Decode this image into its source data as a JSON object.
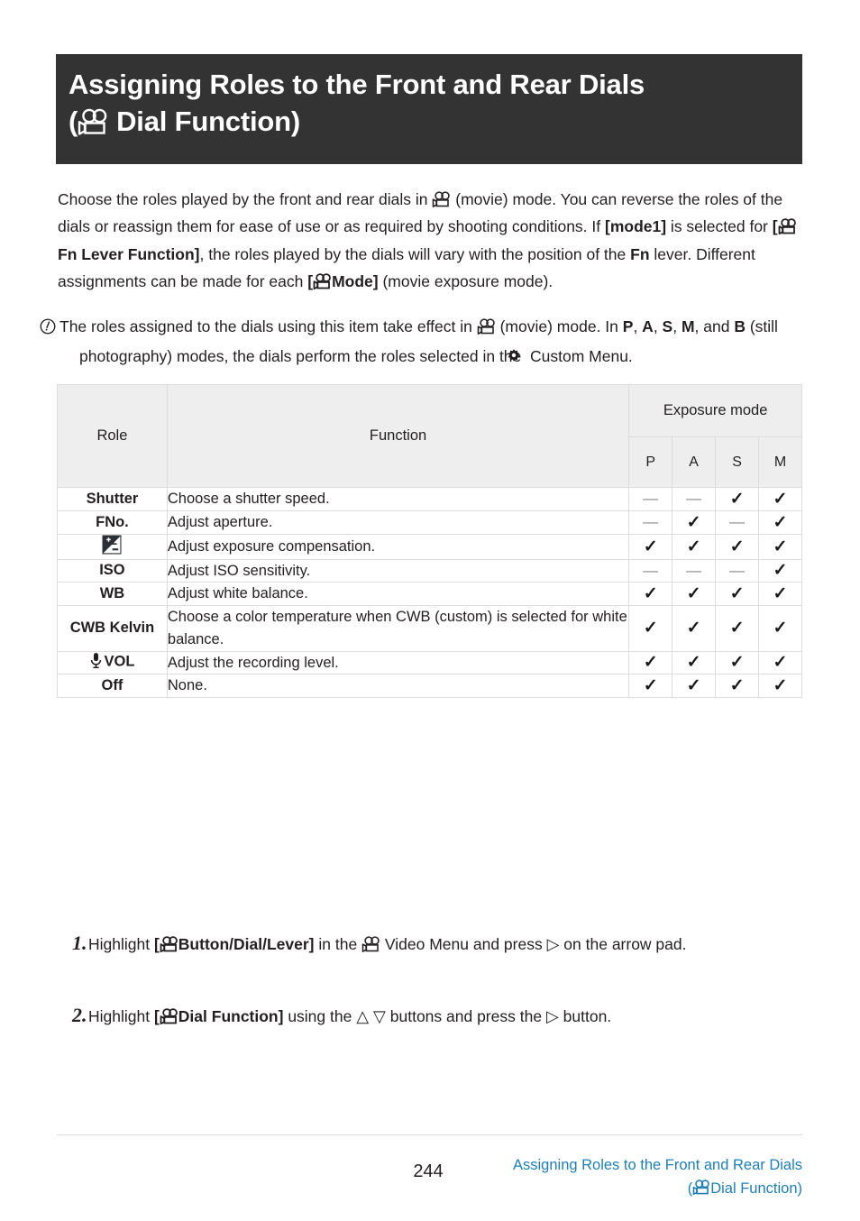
{
  "title": {
    "line1": "Assigning Roles to the Front and Rear Dials",
    "paren_open": "(",
    "line2_text": "Dial Function)",
    "icon": "movie-camera-icon",
    "background_color": "#333333",
    "text_color": "#ffffff"
  },
  "intro": {
    "s1": "Choose the roles played by the front and rear dials in ",
    "s2": " (movie) mode. You can reverse the roles of the dials or reassign them for ease of use or as required by shooting conditions. If ",
    "b1": "[mode1]",
    "s3": " is selected for ",
    "b2_open": "[",
    "b2_text": "Fn Lever Function]",
    "s4": ", the roles played by the dials will vary with the position of the ",
    "b3": "Fn",
    "s5": " lever. Different assignments can be made for each ",
    "b4_open": "[",
    "b4_text": "Mode]",
    "s6": " (movie exposure mode)."
  },
  "note": {
    "icon": "caution-icon",
    "s1": "The roles assigned to the dials using this item take effect in ",
    "s2": " (movie) mode. In ",
    "modes": [
      "P",
      "A",
      "S",
      "M"
    ],
    "sep": ", ",
    "and": ", and ",
    "mode_b": "B",
    "s3": " (still photography) modes, the dials perform the roles selected in the ",
    "gear": "gear-icon",
    "s4": " Custom Menu."
  },
  "table": {
    "headers": {
      "role": "Role",
      "function": "Function",
      "exposure_mode": "Exposure mode",
      "modes": [
        "P",
        "A",
        "S",
        "M"
      ]
    },
    "rows": [
      {
        "role": "Shutter",
        "role_icon": null,
        "function": "Choose a shutter speed.",
        "marks": [
          "—",
          "—",
          "✓",
          "✓"
        ]
      },
      {
        "role": "FNo.",
        "role_icon": null,
        "function": "Adjust aperture.",
        "marks": [
          "—",
          "✓",
          "—",
          "✓"
        ]
      },
      {
        "role": "",
        "role_icon": "exposure-compensation-icon",
        "function": "Adjust exposure compensation.",
        "marks": [
          "✓",
          "✓",
          "✓",
          "✓"
        ]
      },
      {
        "role": "ISO",
        "role_icon": null,
        "function": "Adjust ISO sensitivity.",
        "marks": [
          "—",
          "—",
          "—",
          "✓"
        ]
      },
      {
        "role": "WB",
        "role_icon": null,
        "function": "Adjust white balance.",
        "marks": [
          "✓",
          "✓",
          "✓",
          "✓"
        ]
      },
      {
        "role": "CWB Kelvin",
        "role_icon": null,
        "function": "Choose a color temperature when CWB (custom) is selected for white balance.",
        "marks": [
          "✓",
          "✓",
          "✓",
          "✓"
        ]
      },
      {
        "role": "VOL",
        "role_icon": "microphone-icon",
        "function": "Adjust the recording level.",
        "marks": [
          "✓",
          "✓",
          "✓",
          "✓"
        ]
      },
      {
        "role": "Off",
        "role_icon": null,
        "function": "None.",
        "marks": [
          "✓",
          "✓",
          "✓",
          "✓"
        ]
      }
    ]
  },
  "steps": [
    {
      "number": "1.",
      "s1": "Highlight ",
      "b_open": "[",
      "b_text": "Button/Dial/Lever]",
      "s2": " in the ",
      "s3": " Video Menu and press ",
      "arrow": "▷",
      "s4": " on the arrow pad."
    },
    {
      "number": "2.",
      "s1": "Highlight ",
      "b_open": "[",
      "b_text": "Dial Function]",
      "s2": " using the ",
      "arrows_up_down": "△ ▽",
      "s3": " buttons and press the ",
      "arrow": "▷",
      "s4": " button."
    }
  ],
  "footer": {
    "page_number": "244",
    "link_line1": "Assigning Roles to the Front and Rear Dials",
    "link_paren_open": "(",
    "link_line2": "Dial Function)",
    "link_color": "#1f7fb5"
  }
}
